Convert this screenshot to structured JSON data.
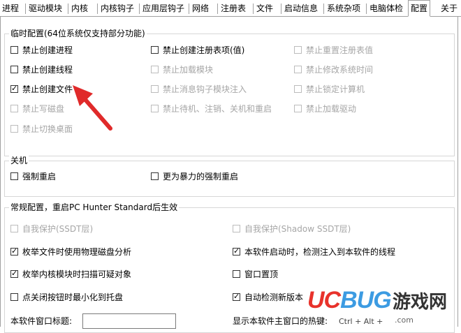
{
  "tabs": [
    {
      "label": "进程"
    },
    {
      "label": "驱动模块"
    },
    {
      "label": "内核"
    },
    {
      "label": "内核钩子"
    },
    {
      "label": "应用层钩子"
    },
    {
      "label": "网络"
    },
    {
      "label": "注册表"
    },
    {
      "label": "文件"
    },
    {
      "label": "启动信息"
    },
    {
      "label": "系统杂项"
    },
    {
      "label": "电脑体检"
    },
    {
      "label": "配置",
      "active": true
    },
    {
      "label": "关于"
    }
  ],
  "groups": {
    "temp": {
      "title": "临时配置(64位系统仅支持部分功能)",
      "options": [
        {
          "label": "禁止创建进程",
          "checked": false,
          "enabled": true
        },
        {
          "label": "禁止创建线程",
          "checked": false,
          "enabled": true
        },
        {
          "label": "禁止创建文件",
          "checked": true,
          "enabled": true
        },
        {
          "label": "禁止写磁盘",
          "checked": false,
          "enabled": false
        },
        {
          "label": "禁止切换桌面",
          "checked": false,
          "enabled": false
        },
        {
          "label": "禁止创建注册表项(值)",
          "checked": false,
          "enabled": true
        },
        {
          "label": "禁止加载模块",
          "checked": false,
          "enabled": false
        },
        {
          "label": "禁止消息钩子模块注入",
          "checked": false,
          "enabled": false
        },
        {
          "label": "禁止待机、注销、关机和重启",
          "checked": false,
          "enabled": false
        },
        {
          "label": "禁止重置注册表值",
          "checked": false,
          "enabled": false
        },
        {
          "label": "禁止修改系统时间",
          "checked": false,
          "enabled": false
        },
        {
          "label": "禁止锁定计算机",
          "checked": false,
          "enabled": false
        },
        {
          "label": "禁止加载驱动",
          "checked": false,
          "enabled": false
        }
      ]
    },
    "shutdown": {
      "title": "关机",
      "options": [
        {
          "label": "强制重启",
          "checked": false,
          "enabled": true
        },
        {
          "label": "更为暴力的强制重启",
          "checked": false,
          "enabled": true
        }
      ]
    },
    "general": {
      "title": "常规配置，重启PC Hunter Standard后生效",
      "options": [
        {
          "label": "自我保护(SSDT层)",
          "checked": false,
          "enabled": false
        },
        {
          "label": "枚举文件时使用物理磁盘分析",
          "checked": true,
          "enabled": true
        },
        {
          "label": "枚举内核模块时扫描可疑对象",
          "checked": true,
          "enabled": true
        },
        {
          "label": "点关闭按钮时最小化到托盘",
          "checked": false,
          "enabled": true
        },
        {
          "label": "自我保护(Shadow SSDT层)",
          "checked": false,
          "enabled": false
        },
        {
          "label": "本软件启动时，检测注入到本软件的线程",
          "checked": true,
          "enabled": true
        },
        {
          "label": "窗口置顶",
          "checked": false,
          "enabled": true
        },
        {
          "label": "自动检测新版本",
          "checked": true,
          "enabled": true
        }
      ],
      "window_title_label": "本软件窗口标题:",
      "window_title_value": "",
      "hotkey_label": "显示本软件主窗口的热键:",
      "hotkey_value": "Ctrl + Alt +"
    }
  },
  "watermark": {
    "logo_uc": "UC",
    "logo_bug": "BUG",
    "cn": "游戏网",
    "url": ".com"
  },
  "colors": {
    "logo_red": "#e8322b",
    "logo_blue": "#3c9be2",
    "arrow_red": "#e02a2a"
  }
}
